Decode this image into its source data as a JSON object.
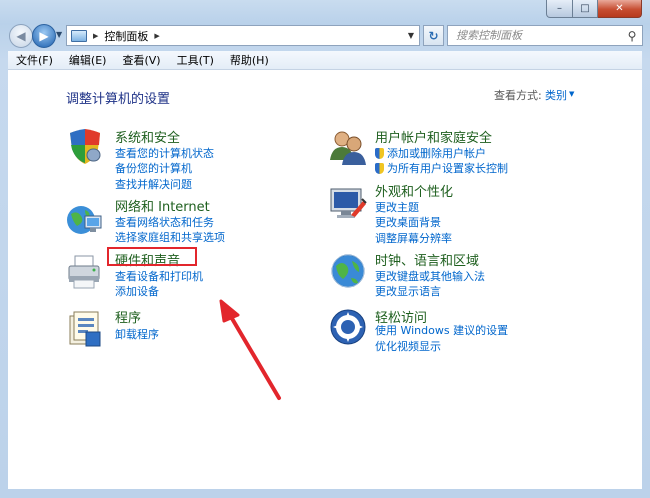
{
  "window": {
    "caption_min": "–",
    "caption_max": "□",
    "caption_close": "✕"
  },
  "address": {
    "breadcrumb": "控制面板",
    "search_placeholder": "搜索控制面板"
  },
  "menu": [
    "文件(F)",
    "编辑(E)",
    "查看(V)",
    "工具(T)",
    "帮助(H)"
  ],
  "page": {
    "title": "调整计算机的设置",
    "view_by_label": "查看方式:",
    "view_by_value": "类别"
  },
  "categories": {
    "system": {
      "title": "系统和安全",
      "links": [
        "查看您的计算机状态",
        "备份您的计算机",
        "查找并解决问题"
      ]
    },
    "network": {
      "title": "网络和 Internet",
      "links": [
        "查看网络状态和任务",
        "选择家庭组和共享选项"
      ]
    },
    "hardware": {
      "title": "硬件和声音",
      "links": [
        "查看设备和打印机",
        "添加设备"
      ]
    },
    "programs": {
      "title": "程序",
      "links": [
        "卸载程序"
      ]
    },
    "users": {
      "title": "用户帐户和家庭安全",
      "links": [
        "添加或删除用户帐户",
        "为所有用户设置家长控制"
      ]
    },
    "appearance": {
      "title": "外观和个性化",
      "links": [
        "更改主题",
        "更改桌面背景",
        "调整屏幕分辨率"
      ]
    },
    "clock": {
      "title": "时钟、语言和区域",
      "links": [
        "更改键盘或其他输入法",
        "更改显示语言"
      ]
    },
    "ease": {
      "title": "轻松访问",
      "links": [
        "使用 Windows 建议的设置",
        "优化视频显示"
      ]
    }
  },
  "colors": {
    "category_title": "#1e5f1e",
    "link": "#0066cc",
    "annotation": "#e2262c"
  }
}
